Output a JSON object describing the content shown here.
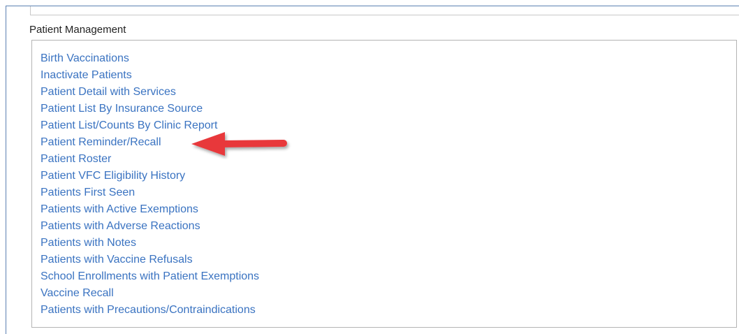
{
  "section": {
    "heading": "Patient Management"
  },
  "reports": [
    "Birth Vaccinations",
    "Inactivate Patients",
    "Patient Detail with Services",
    "Patient List By Insurance Source",
    "Patient List/Counts By Clinic Report",
    "Patient Reminder/Recall",
    "Patient Roster",
    "Patient VFC Eligibility History",
    "Patients First Seen",
    "Patients with Active Exemptions",
    "Patients with Adverse Reactions",
    "Patients with Notes",
    "Patients with Vaccine Refusals",
    "School Enrollments with Patient Exemptions",
    "Vaccine Recall",
    "Patients with Precautions/Contraindications"
  ],
  "annotation": {
    "icon": "arrow-left-icon",
    "points_to": "Patient Reminder/Recall",
    "color": "#e8383b"
  },
  "colors": {
    "link": "#3a73c1",
    "frame": "#5b80b2",
    "box_border": "#b4b4b4"
  }
}
